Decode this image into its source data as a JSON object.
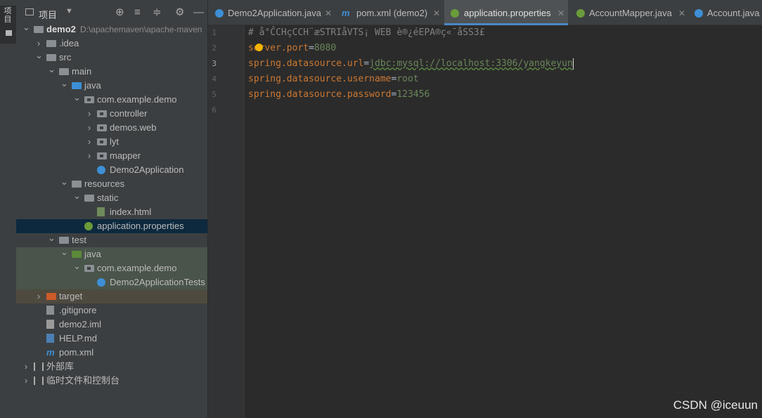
{
  "sidebar_stripe": {
    "label": "项目"
  },
  "project_panel": {
    "title": "项目",
    "tools": [
      "⊕",
      "≡",
      "≑",
      "⚙",
      "—"
    ],
    "tree": [
      {
        "label": "demo2",
        "path": "D:\\apachemaven\\apache-maven",
        "depth": 0,
        "chevron": "open",
        "icon": "module-folder"
      },
      {
        "label": ".idea",
        "depth": 1,
        "chevron": "closed",
        "icon": "folder"
      },
      {
        "label": "src",
        "depth": 1,
        "chevron": "open",
        "icon": "folder"
      },
      {
        "label": "main",
        "depth": 2,
        "chevron": "open",
        "icon": "folder"
      },
      {
        "label": "java",
        "depth": 3,
        "chevron": "open",
        "icon": "source-folder"
      },
      {
        "label": "com.example.demo",
        "depth": 4,
        "chevron": "open",
        "icon": "package"
      },
      {
        "label": "controller",
        "depth": 5,
        "chevron": "closed",
        "icon": "package"
      },
      {
        "label": "demos.web",
        "depth": 5,
        "chevron": "closed",
        "icon": "package"
      },
      {
        "label": "lyt",
        "depth": 5,
        "chevron": "closed",
        "icon": "package"
      },
      {
        "label": "mapper",
        "depth": 5,
        "chevron": "closed",
        "icon": "package"
      },
      {
        "label": "Demo2Application",
        "depth": 5,
        "chevron": "none",
        "icon": "spring-class"
      },
      {
        "label": "resources",
        "depth": 3,
        "chevron": "open",
        "icon": "resources-folder"
      },
      {
        "label": "static",
        "depth": 4,
        "chevron": "open",
        "icon": "folder"
      },
      {
        "label": "index.html",
        "depth": 5,
        "chevron": "none",
        "icon": "html-file"
      },
      {
        "label": "application.properties",
        "depth": 4,
        "chevron": "none",
        "icon": "spring-properties",
        "selected": true
      },
      {
        "label": "test",
        "depth": 2,
        "chevron": "open",
        "icon": "folder"
      },
      {
        "label": "java",
        "depth": 3,
        "chevron": "open",
        "icon": "test-folder",
        "highlight": "test"
      },
      {
        "label": "com.example.demo",
        "depth": 4,
        "chevron": "open",
        "icon": "package",
        "highlight": "test"
      },
      {
        "label": "Demo2ApplicationTests",
        "depth": 5,
        "chevron": "none",
        "icon": "test-class",
        "highlight": "test"
      },
      {
        "label": "target",
        "depth": 1,
        "chevron": "closed",
        "icon": "excluded-folder",
        "highlight": "target"
      },
      {
        "label": ".gitignore",
        "depth": 1,
        "chevron": "none",
        "icon": "gitignore-file"
      },
      {
        "label": "demo2.iml",
        "depth": 1,
        "chevron": "none",
        "icon": "iml-file"
      },
      {
        "label": "HELP.md",
        "depth": 1,
        "chevron": "none",
        "icon": "md-file"
      },
      {
        "label": "pom.xml",
        "depth": 1,
        "chevron": "none",
        "icon": "maven-file"
      },
      {
        "label": "外部库",
        "depth": 0,
        "chevron": "closed",
        "icon": "libraries"
      },
      {
        "label": "临时文件和控制台",
        "depth": 0,
        "chevron": "closed",
        "icon": "scratches"
      }
    ]
  },
  "tabs": [
    {
      "label": "Demo2Application.java",
      "icon": "spring-class",
      "color": "#3d8fd6",
      "active": false
    },
    {
      "label": "pom.xml (demo2)",
      "icon": "maven-file",
      "color": "#3d8fd6",
      "active": false
    },
    {
      "label": "application.properties",
      "icon": "spring-properties",
      "color": "#6a9c3a",
      "active": true
    },
    {
      "label": "AccountMapper.java",
      "icon": "interface-class",
      "color": "#6a9c3a",
      "active": false
    },
    {
      "label": "Account.java",
      "icon": "java-class",
      "color": "#3d8fd6",
      "active": false
    }
  ],
  "editor": {
    "current_line": 3,
    "lines": [
      {
        "n": "1",
        "comment": "# å°ĈCHçCCH¨æSTRIåVTS¡ WEB è®¿éEPA®ç«¯åSS3£"
      },
      {
        "n": "2",
        "key": "server.port",
        "value": "8080"
      },
      {
        "n": "3",
        "key": "spring.datasource.url",
        "value": "jdbc:mysql://localhost:3306/yangkeyun"
      },
      {
        "n": "4",
        "key": "spring.datasource.username",
        "value": "root"
      },
      {
        "n": "5",
        "key": "spring.datasource.password",
        "value": "123456"
      },
      {
        "n": "6"
      }
    ]
  },
  "watermark": "CSDN @iceuun"
}
